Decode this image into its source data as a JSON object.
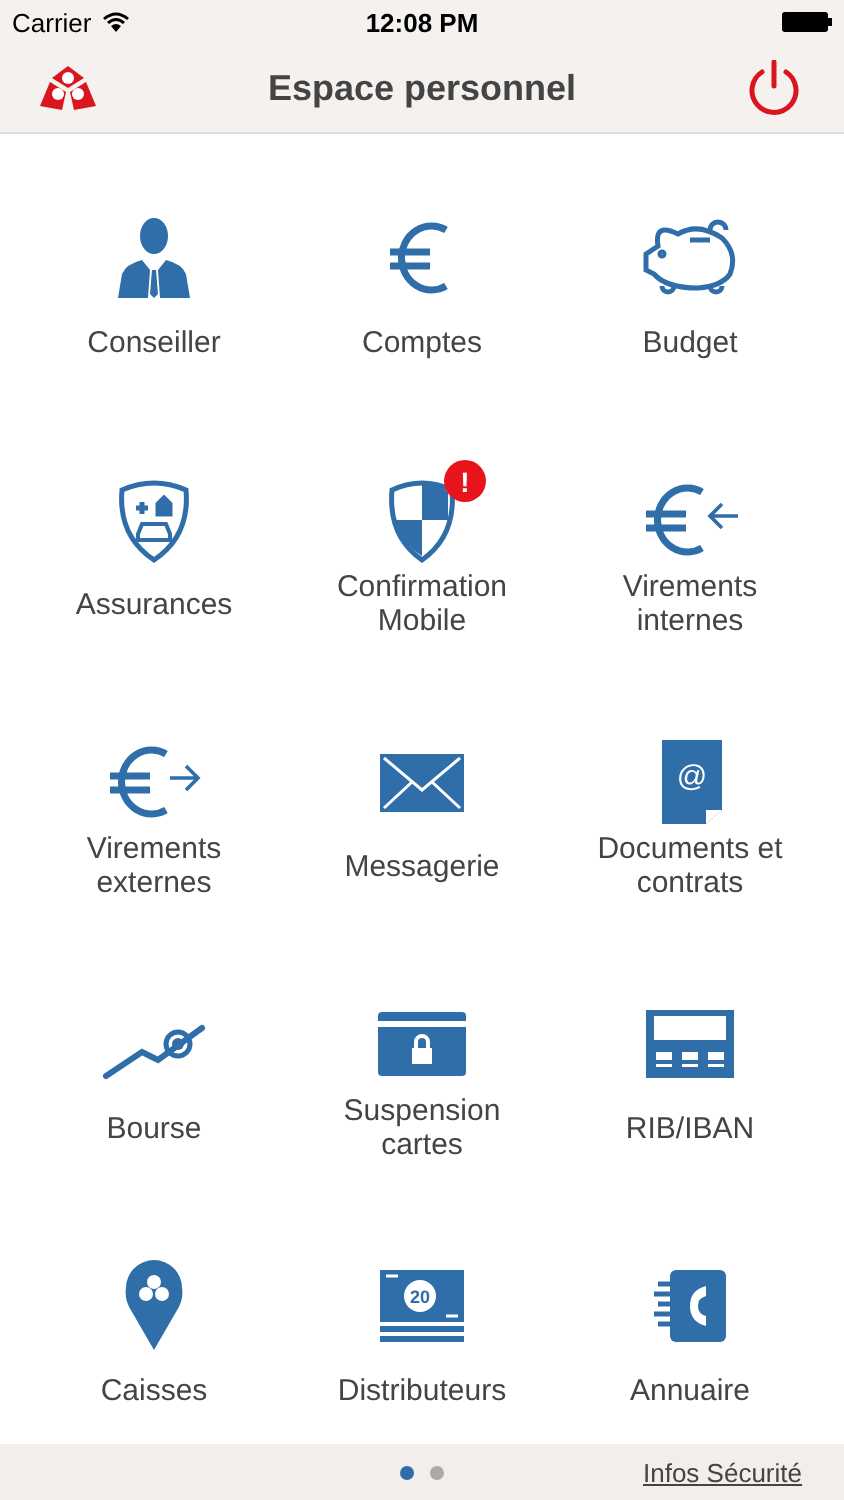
{
  "status_bar": {
    "carrier": "Carrier",
    "time": "12:08 PM"
  },
  "nav": {
    "title": "Espace personnel"
  },
  "tiles": [
    {
      "label": "Conseiller"
    },
    {
      "label": "Comptes"
    },
    {
      "label": "Budget"
    },
    {
      "label": "Assurances"
    },
    {
      "label": "Confirmation Mobile",
      "badge": "!"
    },
    {
      "label": "Virements internes"
    },
    {
      "label": "Virements externes"
    },
    {
      "label": "Messagerie"
    },
    {
      "label": "Documents et contrats",
      "icon_text": "@"
    },
    {
      "label": "Bourse"
    },
    {
      "label": "Suspension cartes"
    },
    {
      "label": "RIB/IBAN"
    },
    {
      "label": "Caisses"
    },
    {
      "label": "Distributeurs",
      "icon_text": "20"
    },
    {
      "label": "Annuaire"
    }
  ],
  "pages": [
    {
      "selected": true
    },
    {
      "selected": false
    }
  ],
  "footer": {
    "link": "Infos Sécurité"
  }
}
